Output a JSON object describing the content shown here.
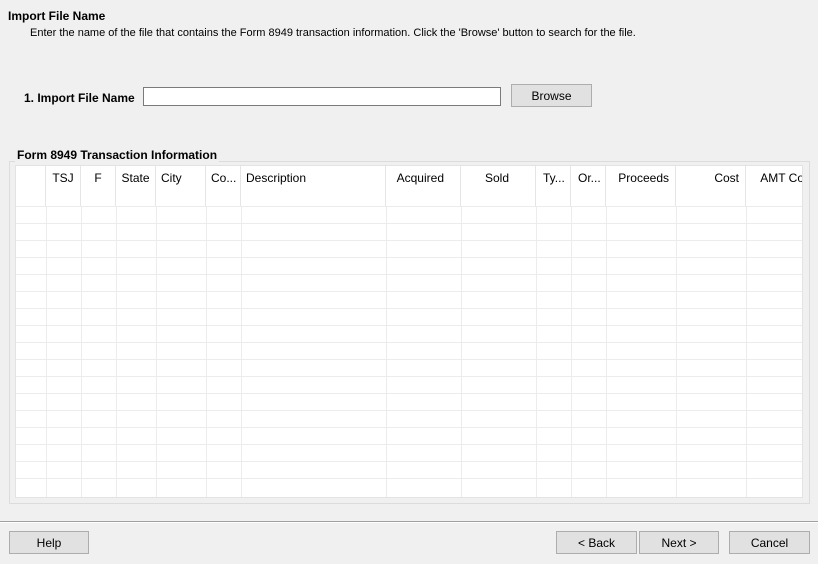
{
  "header": {
    "title": "Import File Name",
    "description": "Enter the name of the file that contains the Form 8949 transaction information. Click the 'Browse' button to search for the file."
  },
  "import": {
    "label": "1. Import File Name",
    "value": "",
    "browse_label": "Browse"
  },
  "transactions": {
    "group_title": "Form 8949 Transaction Information",
    "columns": [
      "",
      "TSJ",
      "F",
      "State",
      "City",
      "Co...",
      "Description",
      "Acquired",
      "Sold",
      "Ty...",
      "Or...",
      "Proceeds",
      "Cost",
      "AMT Co"
    ]
  },
  "footer": {
    "help_label": "Help",
    "back_label": "< Back",
    "next_label": "Next >",
    "cancel_label": "Cancel"
  }
}
